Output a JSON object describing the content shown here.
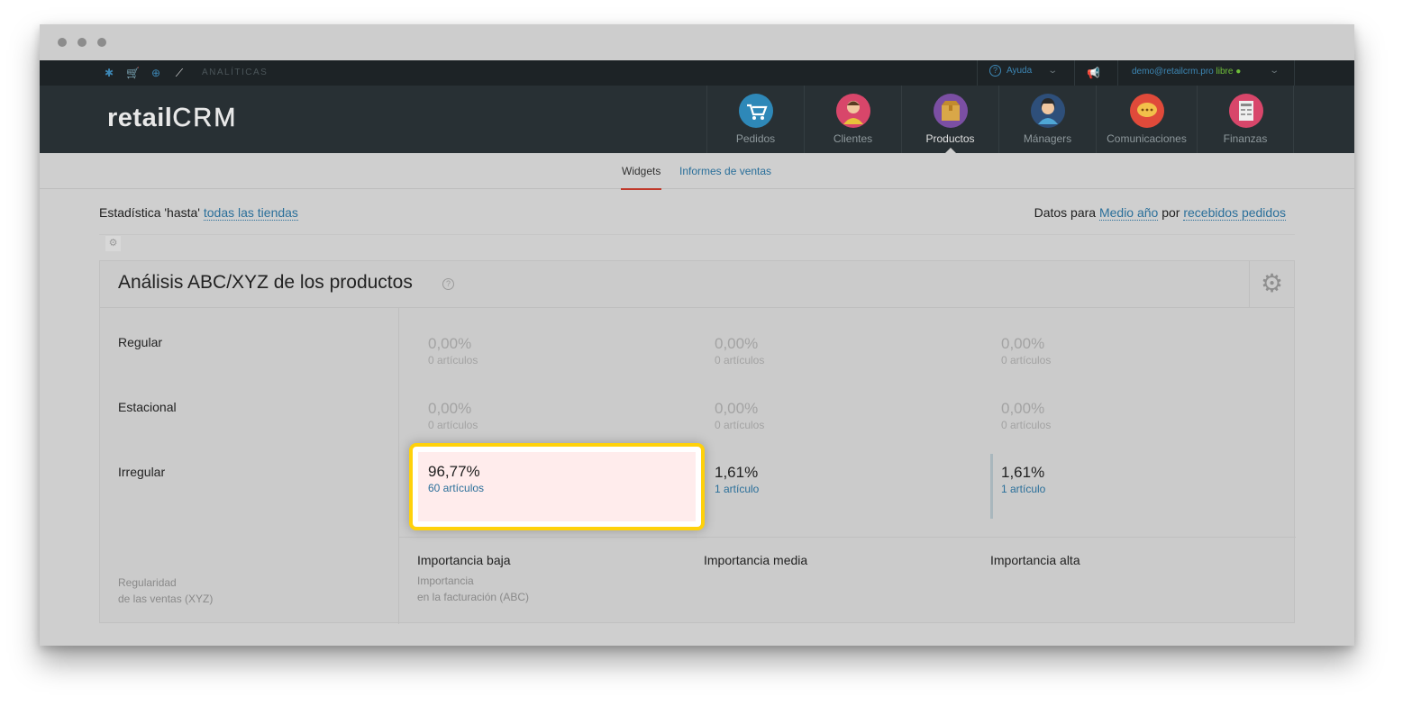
{
  "topbar": {
    "section_label": "ANALÍTICAS",
    "help_label": "Ayuda",
    "user_email": "demo@retailcrm.pro",
    "user_status": "libre"
  },
  "header": {
    "logo_text": "retail",
    "logo_crm": "CRM",
    "nav": [
      {
        "label": "Pedidos",
        "icon": "cart-icon",
        "color": "#2e88b8"
      },
      {
        "label": "Clientes",
        "icon": "customer-icon",
        "color": "#d8466a"
      },
      {
        "label": "Productos",
        "icon": "box-icon",
        "color": "#7b4fa3"
      },
      {
        "label": "Mánagers",
        "icon": "manager-icon",
        "color": "#2e4f7a"
      },
      {
        "label": "Comunicaciones",
        "icon": "chat-icon",
        "color": "#e04a3a"
      },
      {
        "label": "Finanzas",
        "icon": "finance-icon",
        "color": "#d8466a"
      }
    ]
  },
  "subtabs": {
    "widgets": "Widgets",
    "sales_reports": "Informes de ventas"
  },
  "filters": {
    "left_prefix": "Estadística 'hasta'",
    "left_link": "todas las tiendas",
    "right_prefix": "Datos para",
    "right_period": "Medio año",
    "right_middle": "por",
    "right_link": "recebidos pedidos"
  },
  "widget": {
    "title": "Análisis ABC/XYZ de los productos",
    "rows": [
      {
        "label": "Regular",
        "cells": [
          {
            "pct": "0,00%",
            "count": "0 artículos"
          },
          {
            "pct": "0,00%",
            "count": "0 artículos"
          },
          {
            "pct": "0,00%",
            "count": "0 artículos"
          }
        ]
      },
      {
        "label": "Estacional",
        "cells": [
          {
            "pct": "0,00%",
            "count": "0 artículos"
          },
          {
            "pct": "0,00%",
            "count": "0 artículos"
          },
          {
            "pct": "0,00%",
            "count": "0 artículos"
          }
        ]
      },
      {
        "label": "Irregular",
        "cells": [
          {
            "pct": "96,77%",
            "count": "60 artículos"
          },
          {
            "pct": "1,61%",
            "count": "1 artículo"
          },
          {
            "pct": "1,61%",
            "count": "1 artículo"
          }
        ]
      }
    ],
    "columns": [
      "Importancia baja",
      "Importancia media",
      "Importancia alta"
    ],
    "xyz_axis_line1": "Regularidad",
    "xyz_axis_line2": "de las ventas (XYZ)",
    "abc_axis_line1": "Importancia",
    "abc_axis_line2": "en la facturación (ABC)"
  },
  "colors": {
    "highlight_border": "#ffd10a",
    "link": "#2a6f9a",
    "header_bg": "#283034"
  }
}
